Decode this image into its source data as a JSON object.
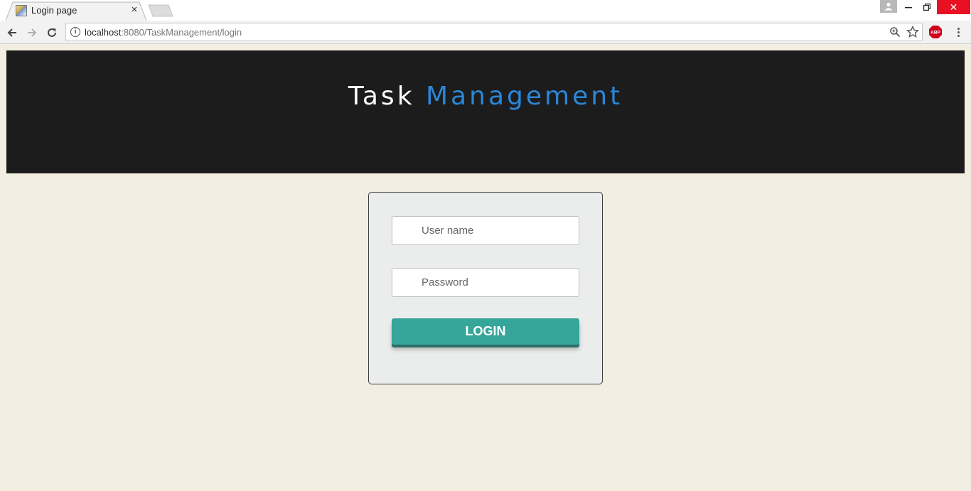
{
  "browser": {
    "tab_title": "Login page",
    "tab_close": "×",
    "url_host": "localhost",
    "url_path": ":8080/TaskManagement/login",
    "icons": {
      "favicon": "favicon-icon",
      "back": "arrow-left-icon",
      "forward": "arrow-right-icon",
      "reload": "reload-icon",
      "info": "info-icon",
      "zoom": "zoom-icon",
      "bookmark": "star-icon",
      "adblock": "abp-icon",
      "menu": "kebab-menu-icon"
    },
    "window_controls": {
      "close_glyph": "✕"
    },
    "colors": {
      "close": "#e81123"
    }
  },
  "page": {
    "brand": {
      "word1": "Task",
      "word2": "Management"
    },
    "form": {
      "username_placeholder": "User name",
      "password_placeholder": "Password",
      "login_label": "LOGIN"
    },
    "colors": {
      "background": "#f2eee2",
      "header": "#1c1c1c",
      "brand_accent": "#2a87d8",
      "button": "#36a59a"
    }
  }
}
